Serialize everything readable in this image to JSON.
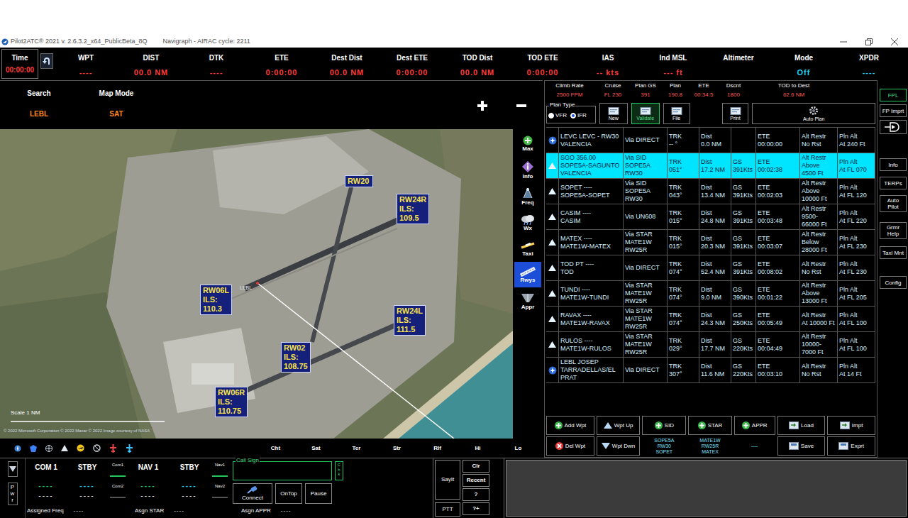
{
  "window": {
    "title": "Pilot2ATC® 2021 v. 2.6.3.2_x64_PublicBeta_8Q",
    "subtitle": "Navigraph - AIRAC cycle: 2211"
  },
  "header": {
    "time": {
      "label": "Time",
      "value": "00:00:00"
    },
    "fields": [
      {
        "label": "WPT",
        "value": "----",
        "color": "#ff3b3b"
      },
      {
        "label": "DIST",
        "value": "00.0 NM",
        "color": "#ff3b3b"
      },
      {
        "label": "DTK",
        "value": "----",
        "color": "#ff3b3b"
      },
      {
        "label": "ETE",
        "value": "0:00:00",
        "color": "#ff3b3b"
      },
      {
        "label": "Dest Dist",
        "value": "00.0 NM",
        "color": "#ff3b3b"
      },
      {
        "label": "Dest ETE",
        "value": "0:00:00",
        "color": "#ff3b3b"
      },
      {
        "label": "TOD Dist",
        "value": "00.0 NM",
        "color": "#ff3b3b"
      },
      {
        "label": "TOD ETE",
        "value": "0:00:00",
        "color": "#ff3b3b"
      },
      {
        "label": "IAS",
        "value": "-- kts",
        "color": "#ff3b3b"
      },
      {
        "label": "Ind MSL",
        "value": "--- ft",
        "color": "#ff3b3b"
      },
      {
        "label": "Altimeter"
      },
      {
        "label": "Mode",
        "value": "Off",
        "color": "#22d3ee"
      },
      {
        "label": "XPDR",
        "value": "----",
        "color": "#22d3ee"
      }
    ]
  },
  "map": {
    "search": {
      "label": "Search",
      "value": "LEBL"
    },
    "mode": {
      "label": "Map Mode",
      "value": "SAT"
    },
    "airport": "LEBL",
    "scale": "Scale 1 NM",
    "attribution": "© 2022 Microsoft Corporation © 2022 Maxar © 2022 Image courtesy of NASA",
    "runways": [
      {
        "lines": [
          "RW20"
        ]
      },
      {
        "lines": [
          "RW24R",
          "ILS:",
          "109.5"
        ]
      },
      {
        "lines": [
          "RW06L",
          "ILS:",
          "110.3"
        ]
      },
      {
        "lines": [
          "RW24L",
          "ILS:",
          "111.5"
        ]
      },
      {
        "lines": [
          "RW02",
          "ILS:",
          "108.75"
        ]
      },
      {
        "lines": [
          "RW06R",
          "ILS:",
          "110.75"
        ]
      }
    ],
    "tools": [
      {
        "label": "Max",
        "selected": false
      },
      {
        "label": "Info",
        "selected": false
      },
      {
        "label": "Freq",
        "selected": false
      },
      {
        "label": "Wx",
        "selected": false
      },
      {
        "label": "Taxi",
        "selected": false
      },
      {
        "label": "Rwys",
        "selected": true
      },
      {
        "label": "Appr",
        "selected": false
      }
    ],
    "layers": [
      "Cht",
      "Sat",
      "Ter",
      "Str",
      "Rlf",
      "Hi",
      "Lo"
    ]
  },
  "plan": {
    "summary": [
      {
        "label": "Climb Rate",
        "value": "2500 FPM"
      },
      {
        "label": "Cruise",
        "value": "FL 230"
      },
      {
        "label": "Plan GS",
        "value": "391"
      },
      {
        "label": "Plan",
        "value": "190.8"
      },
      {
        "label": "ETE",
        "value": "00:34:5"
      },
      {
        "label": "Dscnt",
        "value": "1800"
      },
      {
        "label": "TOD to Dest",
        "value": "62.6 NM"
      }
    ],
    "plan_type": {
      "label": "Plan Type",
      "options": [
        {
          "label": "VFR",
          "selected": false
        },
        {
          "label": "IFR",
          "selected": true
        }
      ]
    },
    "buttons": [
      {
        "label": "New",
        "selected": false
      },
      {
        "label": "Validate",
        "selected": true
      },
      {
        "label": "File",
        "selected": false
      },
      {
        "label": "Print",
        "selected": false
      },
      {
        "label": "Auto Plan",
        "selected": false
      }
    ],
    "rows": [
      {
        "kind": "airport",
        "selected": false,
        "cells": [
          [
            "LEVC  LEVC - RW30",
            "VALENCIA"
          ],
          [
            "Via DIRECT"
          ],
          [
            "TRK",
            "-- °"
          ],
          [
            "Dist",
            "0.0 NM"
          ],
          [],
          [
            "ETE",
            "00:00:00"
          ],
          [
            "Alt Restr",
            "No Rst"
          ],
          [
            "Pln Alt",
            "At 240 Ft"
          ]
        ]
      },
      {
        "kind": "waypoint",
        "selected": true,
        "cells": [
          [
            "SGO  356.00",
            "SOPE5A-SAGUNTO",
            "VALENCIA"
          ],
          [
            "Via SID",
            "SOPE5A",
            "RW30"
          ],
          [
            "TRK",
            "051°"
          ],
          [
            "Dist",
            "17.2 NM"
          ],
          [
            "GS",
            "391Kts"
          ],
          [
            "ETE",
            "00:02:38"
          ],
          [
            "Alt Restr",
            "Above",
            "4500 Ft"
          ],
          [
            "Pln Alt",
            "At FL 070"
          ]
        ]
      },
      {
        "kind": "waypoint",
        "selected": false,
        "cells": [
          [
            "SOPET  ----",
            "SOPE5A-SOPET"
          ],
          [
            "Via SID",
            "SOPE5A",
            "RW30"
          ],
          [
            "TRK",
            "043°"
          ],
          [
            "Dist",
            "13.4 NM"
          ],
          [
            "GS",
            "391Kts"
          ],
          [
            "ETE",
            "00:02:03"
          ],
          [
            "Alt Restr",
            "Above",
            "10000 Ft"
          ],
          [
            "Pln Alt",
            "At FL 120"
          ]
        ]
      },
      {
        "kind": "waypoint",
        "selected": false,
        "cells": [
          [
            "CASIM  ----",
            "CASIM"
          ],
          [
            "Via UN608"
          ],
          [
            "TRK",
            "015°"
          ],
          [
            "Dist",
            "24.8 NM"
          ],
          [
            "GS",
            "391Kts"
          ],
          [
            "ETE",
            "00:03:48"
          ],
          [
            "Alt Restr",
            "9500-",
            "66000 Ft"
          ],
          [
            "Pln Alt",
            "At FL 220"
          ]
        ]
      },
      {
        "kind": "waypoint",
        "selected": false,
        "cells": [
          [
            "MATEX  ----",
            "MATE1W-MATEX"
          ],
          [
            "Via STAR",
            "MATE1W",
            "RW25R"
          ],
          [
            "TRK",
            "015°"
          ],
          [
            "Dist",
            "20.3 NM"
          ],
          [
            "GS",
            "391Kts"
          ],
          [
            "ETE",
            "00:03:07"
          ],
          [
            "Alt Restr",
            "Below",
            "28000 Ft"
          ],
          [
            "Pln Alt",
            "At FL 230"
          ]
        ]
      },
      {
        "kind": "waypoint",
        "selected": false,
        "cells": [
          [
            "TOD PT  ----",
            "TOD"
          ],
          [
            "Via DIRECT"
          ],
          [
            "TRK",
            "074°"
          ],
          [
            "Dist",
            "52.4 NM"
          ],
          [
            "GS",
            "391Kts"
          ],
          [
            "ETE",
            "00:08:02"
          ],
          [
            "Alt Restr",
            "No Rst"
          ],
          [
            "Pln Alt",
            "At FL 230"
          ]
        ]
      },
      {
        "kind": "waypoint",
        "selected": false,
        "cells": [
          [
            "TUNDI  ----",
            "MATE1W-TUNDI"
          ],
          [
            "Via STAR",
            "MATE1W",
            "RW25R"
          ],
          [
            "TRK",
            "074°"
          ],
          [
            "Dist",
            "9.0 NM"
          ],
          [
            "GS",
            "390Kts"
          ],
          [
            "ETE",
            "00:01:22"
          ],
          [
            "Alt Restr",
            "Above",
            "13000 Ft"
          ],
          [
            "Pln Alt",
            "At FL 205"
          ]
        ]
      },
      {
        "kind": "waypoint",
        "selected": false,
        "cells": [
          [
            "RAVAX  ----",
            "MATE1W-RAVAX"
          ],
          [
            "Via STAR",
            "MATE1W",
            "RW25R"
          ],
          [
            "TRK",
            "074°"
          ],
          [
            "Dist",
            "24.3 NM"
          ],
          [
            "GS",
            "250Kts"
          ],
          [
            "ETE",
            "00:05:49"
          ],
          [
            "Alt Restr",
            "At 10000 Ft"
          ],
          [
            "Pln Alt",
            "At FL 100"
          ]
        ]
      },
      {
        "kind": "waypoint",
        "selected": false,
        "cells": [
          [
            "RULOS  ----",
            "MATE1W-RULOS"
          ],
          [
            "Via STAR",
            "MATE1W",
            "RW25R"
          ],
          [
            "TRK",
            "029°"
          ],
          [
            "Dist",
            "17.7 NM"
          ],
          [
            "GS",
            "220Kts"
          ],
          [
            "ETE",
            "00:04:49"
          ],
          [
            "Alt Restr",
            "10000-",
            "7000 Ft"
          ],
          [
            "Pln Alt",
            "At FL 100"
          ]
        ]
      },
      {
        "kind": "airport",
        "selected": false,
        "cells": [
          [
            "LEBL  JOSEP",
            "TARRADELLAS/EL",
            "PRAT"
          ],
          [
            "Via DIRECT"
          ],
          [
            "TRK",
            "307°"
          ],
          [
            "Dist",
            "11.6 NM"
          ],
          [
            "GS",
            "220Kts"
          ],
          [
            "ETE",
            "00:03:10"
          ],
          [
            "Alt Restr",
            "No Rst"
          ],
          [
            "Pln Alt",
            "At 14 Ft"
          ]
        ]
      }
    ],
    "actions_top": [
      {
        "label": "Add Wpt",
        "kind": "add"
      },
      {
        "label": "Wpt Up",
        "kind": "up"
      },
      {
        "label": "SID",
        "kind": "add"
      },
      {
        "label": "STAR",
        "kind": "add"
      },
      {
        "label": "APPR",
        "kind": "add"
      },
      {
        "label": "Load",
        "kind": "load"
      },
      {
        "label": "Impt",
        "kind": "load"
      }
    ],
    "actions_bottom": [
      {
        "label": "Del Wpt",
        "kind": "delete"
      },
      {
        "label": "Wpt Dwn",
        "kind": "down"
      },
      {
        "label": "Save",
        "kind": "save"
      },
      {
        "label": "Exprt",
        "kind": "save"
      }
    ],
    "procedures": [
      [
        "SOPE5A",
        "RW30",
        "SOPET"
      ],
      [
        "MATE1W",
        "RW25R",
        "MATEX"
      ],
      [
        "----"
      ]
    ]
  },
  "side_buttons": [
    {
      "kind": "text",
      "label": "FPL",
      "selected": true
    },
    {
      "kind": "text",
      "label": "FP Imprt",
      "selected": false
    },
    {
      "kind": "icon",
      "selected": false
    },
    {
      "kind": "text",
      "label": "Info",
      "selected": false
    },
    {
      "kind": "text",
      "label": "TERPs",
      "selected": false
    },
    {
      "kind": "text",
      "label": "Auto Pilot",
      "selected": false
    },
    {
      "kind": "text",
      "label": "Grmr Help",
      "selected": false
    },
    {
      "kind": "text",
      "label": "Taxi Mnt",
      "selected": false
    },
    {
      "kind": "text",
      "label": "Config",
      "selected": false
    }
  ],
  "radio": {
    "power": "Pwr",
    "com": {
      "active": {
        "label": "COM 1",
        "value": "----",
        "sub": "----"
      },
      "standby": {
        "label": "STBY",
        "value": "----",
        "sub": "----"
      },
      "selectors": [
        {
          "label": "Com1",
          "on": true
        },
        {
          "label": "Com2",
          "on": false
        }
      ]
    },
    "nav": {
      "active": {
        "label": "NAV 1",
        "value": "----",
        "sub": "----"
      },
      "standby": {
        "label": "STBY",
        "value": "----",
        "sub": "----"
      },
      "selectors": [
        {
          "label": "Nav1",
          "on": true
        },
        {
          "label": "Nav2",
          "on": false
        }
      ]
    },
    "callsign": {
      "label": "Call Sign",
      "check": "Chk"
    },
    "buttons": [
      "Connect",
      "OnTop",
      "Pause"
    ],
    "assignments": [
      {
        "label": "Assigned Freq",
        "value": "----"
      },
      {
        "label": "Asgn STAR",
        "value": "----"
      },
      {
        "label": "Asgn APPR",
        "value": "----"
      }
    ]
  },
  "voice": {
    "sayit": "SayIt",
    "ptt": "PTT",
    "buttons": [
      "Clr",
      "Recent",
      "?",
      "?+"
    ]
  }
}
